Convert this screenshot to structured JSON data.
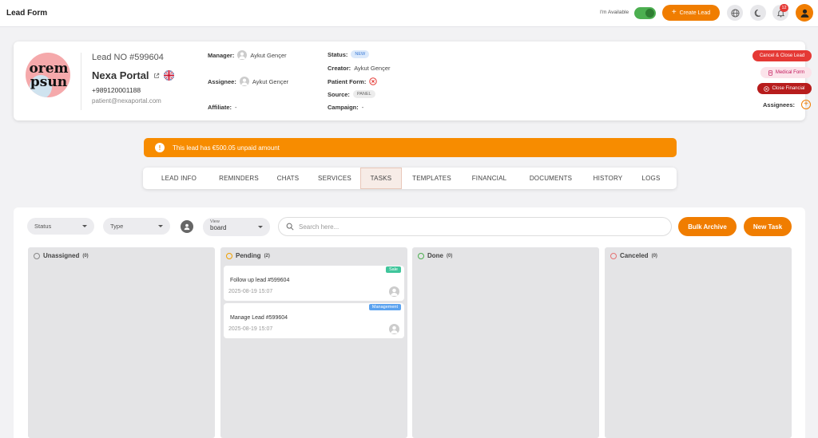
{
  "header": {
    "title": "Lead Form",
    "availability_label": "I'm Available",
    "create_lead_label": "Create Lead",
    "notification_count": "12"
  },
  "lead": {
    "avatar_lines": [
      "orem",
      "psun"
    ],
    "number": "Lead NO #599604",
    "name": "Nexa Portal",
    "phone": "+989120001188",
    "email": "patient@nexaportal.com",
    "manager_label": "Manager:",
    "manager": "Aykut Gençer",
    "assignee_label": "Assignee:",
    "assignee": "Aykut Gençer",
    "affiliate_label": "Affiliate:",
    "affiliate": "-",
    "status_label": "Status:",
    "status": "NEW",
    "creator_label": "Creator:",
    "creator": "Aykut Gençer",
    "patient_form_label": "Patient Form:",
    "source_label": "Source:",
    "source": "PANEL",
    "campaign_label": "Campaign:",
    "campaign": "-",
    "actions": {
      "cancel_close": "Cancel & Close Lead",
      "medical_form": "Medical Form",
      "close_financial": "Close Financial"
    },
    "assignees_label": "Assignees:"
  },
  "alert": {
    "text": "This lead has €500.05 unpaid amount"
  },
  "tabs": [
    {
      "label": "LEAD INFO",
      "active": false
    },
    {
      "label": "REMINDERS",
      "active": false
    },
    {
      "label": "CHATS",
      "active": false
    },
    {
      "label": "SERVICES",
      "active": false
    },
    {
      "label": "TASKS",
      "active": true
    },
    {
      "label": "TEMPLATES",
      "active": false
    },
    {
      "label": "FINANCIAL",
      "active": false
    },
    {
      "label": "DOCUMENTS",
      "active": false
    },
    {
      "label": "HISTORY",
      "active": false
    },
    {
      "label": "LOGS",
      "active": false
    }
  ],
  "filters": {
    "status_placeholder": "Status",
    "type_placeholder": "Type",
    "view_label": "View",
    "view_value": "board",
    "search_placeholder": "Search here...",
    "bulk_archive_label": "Bulk Archive",
    "new_task_label": "New Task"
  },
  "columns": [
    {
      "title": "Unassigned",
      "count": "(0)",
      "color": "#888888",
      "tasks": []
    },
    {
      "title": "Pending",
      "count": "(2)",
      "color": "#f0a000",
      "tasks": [
        {
          "title": "Follow up lead #599604",
          "date": "2025-08-19 15:07",
          "tag": "Sale",
          "tag_color": "#3fc59b"
        },
        {
          "title": "Manage Lead #599604",
          "date": "2025-08-19 15:07",
          "tag": "Management",
          "tag_color": "#5aa2ef"
        }
      ]
    },
    {
      "title": "Done",
      "count": "(0)",
      "color": "#4caf50",
      "tasks": []
    },
    {
      "title": "Canceled",
      "count": "(0)",
      "color": "#e57373",
      "tasks": []
    }
  ],
  "colors": {
    "accent": "#f07d00",
    "alert": "#f78c00",
    "danger": "#e53935"
  }
}
